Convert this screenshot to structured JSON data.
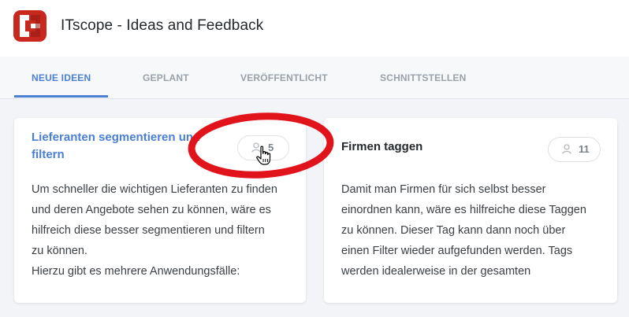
{
  "header": {
    "title": "ITscope - Ideas and Feedback",
    "logo_icon": "itscope-logo-icon",
    "brand_color": "#c8281e"
  },
  "tabs": [
    {
      "label": "NEUE IDEEN",
      "active": true
    },
    {
      "label": "GEPLANT",
      "active": false
    },
    {
      "label": "VERÖFFENTLICHT",
      "active": false
    },
    {
      "label": "SCHNITTSTELLEN",
      "active": false
    }
  ],
  "accent_color": "#4a7fd4",
  "annotation_color": "#e2141b",
  "ideas": [
    {
      "title": "Lieferanten segmentieren und filtern",
      "votes": "5",
      "vote_icon": "user-icon",
      "body": [
        "Um schneller die wichtigen Lieferanten zu finden",
        "und deren Angebote sehen zu können, wäre es",
        "hilfreich diese besser segmentieren und filtern",
        "zu können.",
        "Hierzu gibt es mehrere Anwendungsfälle:"
      ]
    },
    {
      "title": "Firmen taggen",
      "votes": "11",
      "vote_icon": "user-icon",
      "body": [
        "Damit man Firmen für sich selbst besser",
        "einordnen kann, wäre es hilfreiche diese Taggen",
        "zu können. Dieser Tag kann dann noch über",
        "einen Filter wieder aufgefunden werden. Tags",
        "werden idealerweise in der gesamten"
      ]
    }
  ]
}
